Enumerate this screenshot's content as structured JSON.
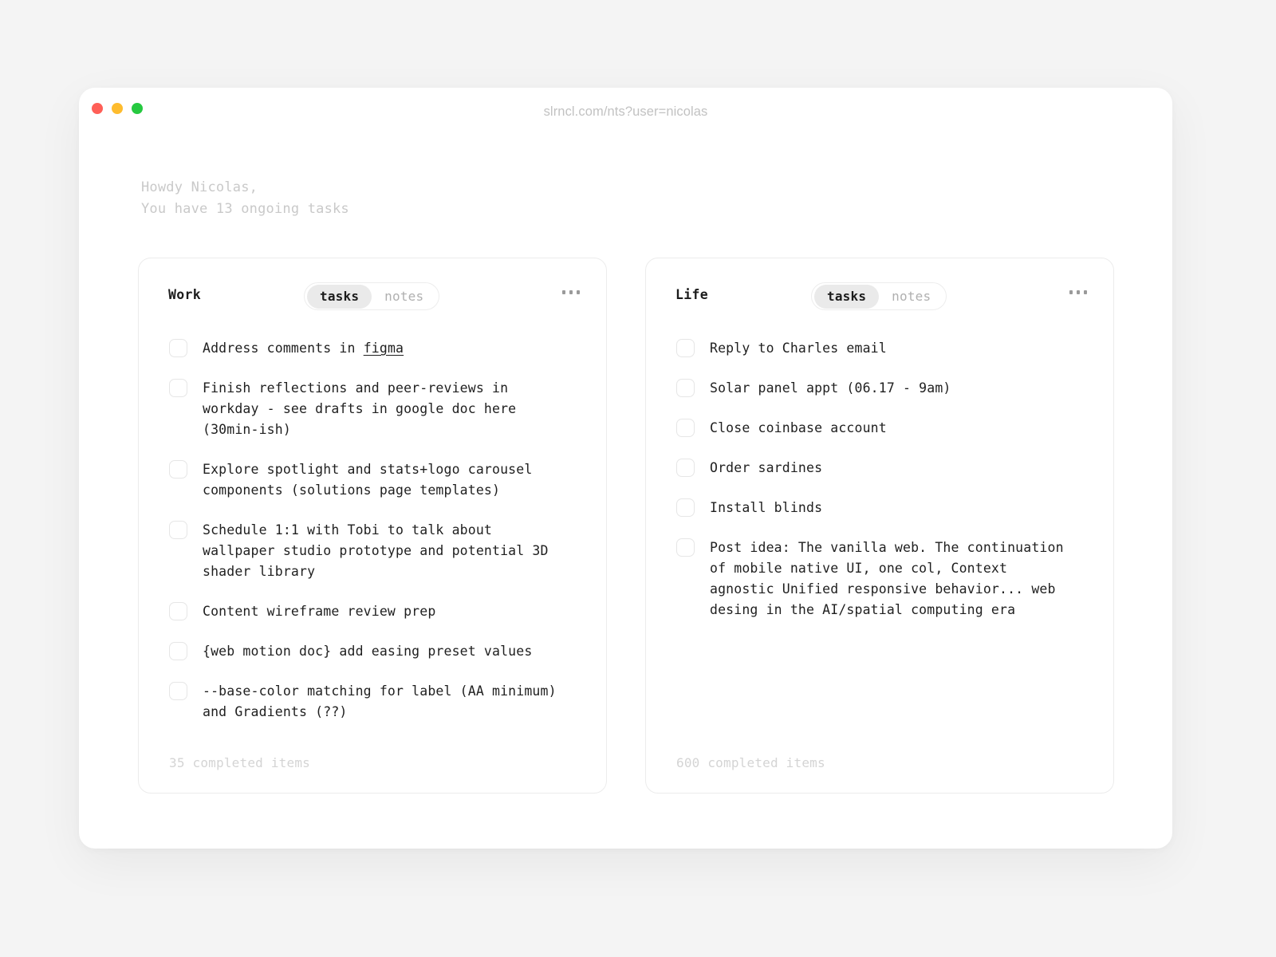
{
  "window": {
    "url": "slrncl.com/nts?user=nicolas",
    "traffic_lights": [
      {
        "name": "close",
        "color": "#ff5f57"
      },
      {
        "name": "minimize",
        "color": "#febc2e"
      },
      {
        "name": "maximize",
        "color": "#26c940"
      }
    ]
  },
  "greeting": {
    "line1": "Howdy Nicolas,",
    "line2": "You have 13 ongoing tasks"
  },
  "toggle_options": {
    "tasks": "tasks",
    "notes": "notes"
  },
  "cards": [
    {
      "title": "Work",
      "active_tab": "tasks",
      "menu_icon": "kebab-icon",
      "footer": "35 completed items",
      "tasks": [
        {
          "text_before": "Address comments in ",
          "link": "figma",
          "text_after": ""
        },
        {
          "text": "Finish reflections and peer-reviews in workday - see drafts in google doc here (30min-ish)"
        },
        {
          "text": "Explore spotlight and stats+logo carousel components (solutions page templates)"
        },
        {
          "text": "Schedule 1:1 with Tobi to talk about wallpaper studio prototype and potential 3D shader library"
        },
        {
          "text": "Content wireframe review prep"
        },
        {
          "text": "{web motion doc} add easing preset values"
        },
        {
          "text": "--base-color matching for label (AA minimum) and Gradients (??)"
        }
      ]
    },
    {
      "title": "Life",
      "active_tab": "tasks",
      "menu_icon": "kebab-icon",
      "footer": "600 completed items",
      "tasks": [
        {
          "text": "Reply to Charles email"
        },
        {
          "text": "Solar panel appt (06.17 - 9am)"
        },
        {
          "text": "Close coinbase account"
        },
        {
          "text": "Order sardines"
        },
        {
          "text": "Install blinds"
        },
        {
          "text": "Post idea: The vanilla web. The continuation of mobile native UI, one col, Context agnostic Unified responsive behavior... web desing in the AI/spatial computing era"
        }
      ]
    }
  ]
}
